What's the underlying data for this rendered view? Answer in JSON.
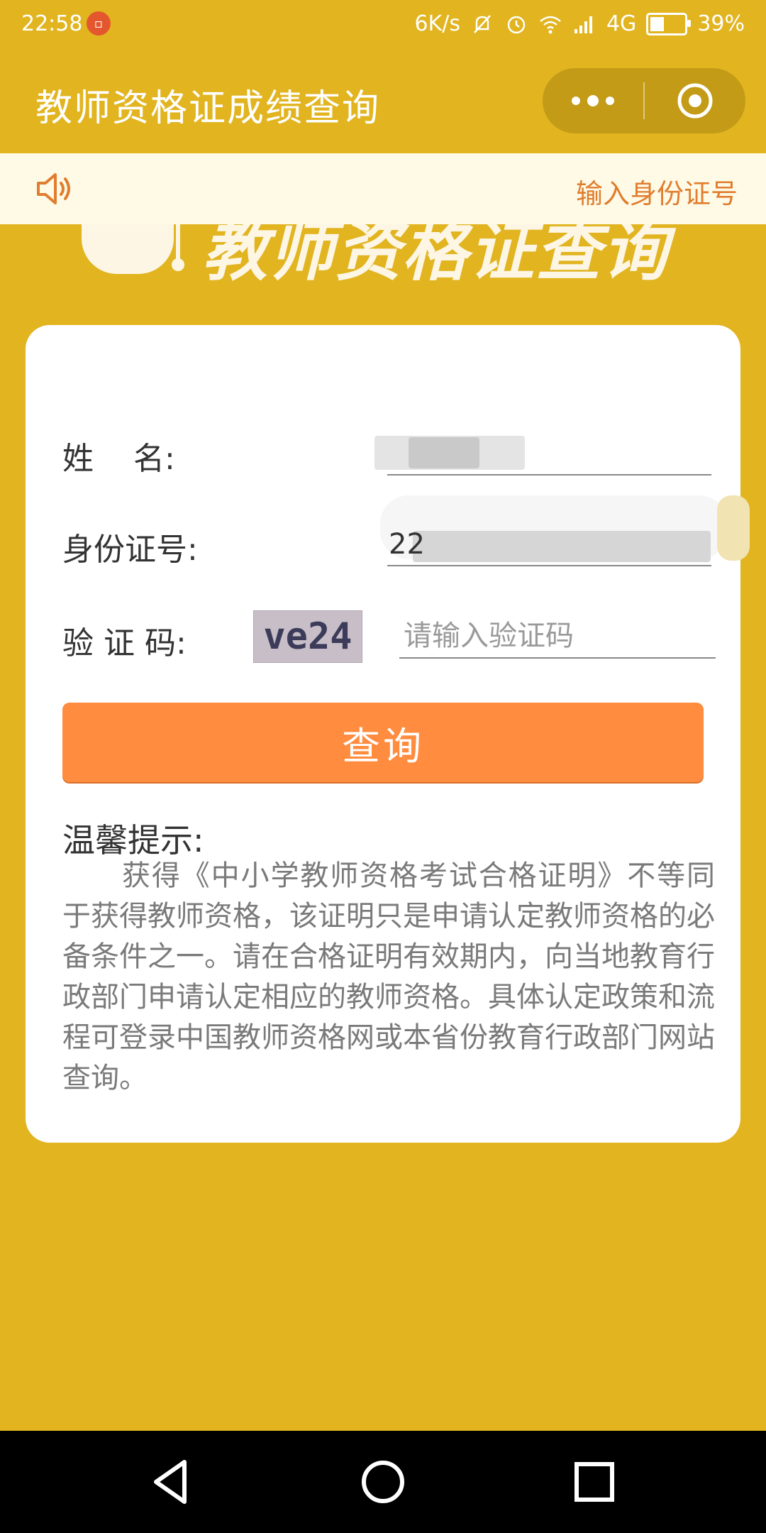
{
  "status_bar": {
    "time": "22:58",
    "notification_icon": "app-notification-icon",
    "speed": "6K/s",
    "network": "4G",
    "battery": "39%",
    "battery_level": 0.39
  },
  "titlebar": {
    "title": "教师资格证成绩查询",
    "more_icon": "more-dots-icon",
    "close_icon": "target-close-icon"
  },
  "notice": {
    "icon": "speaker-icon",
    "text": "输入身份证号"
  },
  "banner": {
    "text": "教师资格证查询"
  },
  "form": {
    "name_label": "姓    名:",
    "id_label": "身份证号:",
    "id_prefix": "22",
    "captcha_label": "验 证 码:",
    "captcha_text": "ve24",
    "captcha_placeholder": "请输入验证码",
    "submit_label": "查询"
  },
  "tips": {
    "title": "温馨提示:",
    "body": "获得《中小学教师资格考试合格证明》不等同于获得教师资格，该证明只是申请认定教师资格的必备条件之一。请在合格证明有效期内，向当地教育行政部门申请认定相应的教师资格。具体认定政策和流程可登录中国教师资格网或本省份教育行政部门网站查询。"
  },
  "colors": {
    "background": "#E1B420",
    "button": "#FF8C3F",
    "notice_bg": "#FEFAE6",
    "notice_text": "#E07D2E"
  }
}
